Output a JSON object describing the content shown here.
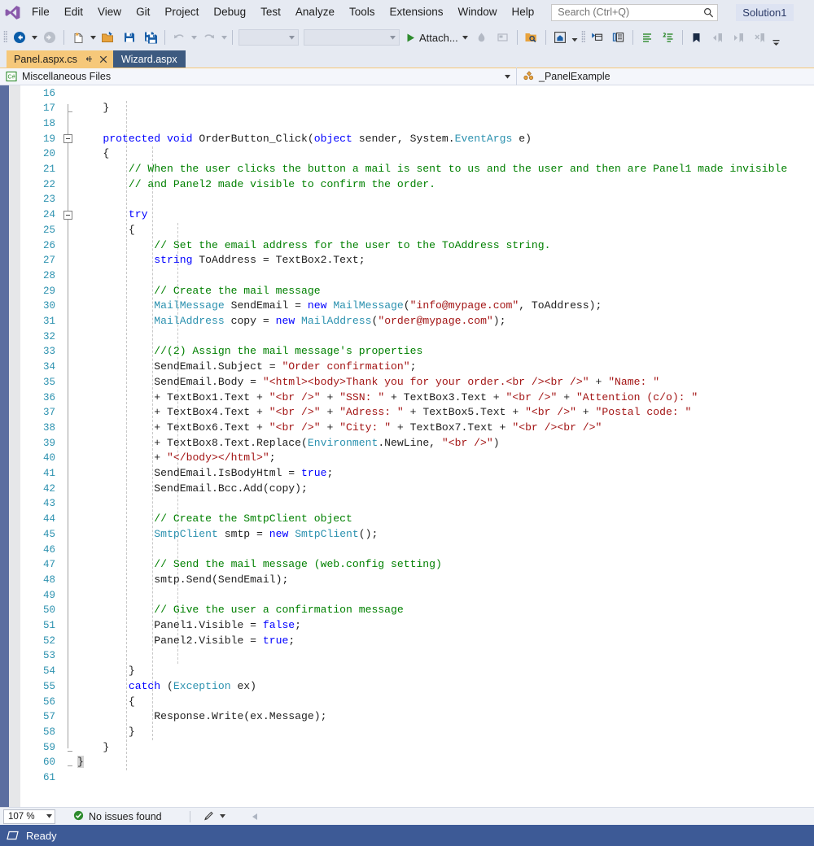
{
  "window": {
    "solution_name": "Solution1"
  },
  "menubar": {
    "logo_icon": "visual-studio-logo",
    "items": [
      {
        "label": "File"
      },
      {
        "label": "Edit"
      },
      {
        "label": "View"
      },
      {
        "label": "Git"
      },
      {
        "label": "Project"
      },
      {
        "label": "Debug"
      },
      {
        "label": "Test"
      },
      {
        "label": "Analyze"
      },
      {
        "label": "Tools"
      },
      {
        "label": "Extensions"
      },
      {
        "label": "Window"
      },
      {
        "label": "Help"
      }
    ],
    "search": {
      "placeholder": "Search (Ctrl+Q)",
      "value": "",
      "icon": "search-icon"
    }
  },
  "toolbar": {
    "attach_label": "Attach...",
    "config_combo": "",
    "platform_combo": "",
    "buttons": [
      {
        "name": "navigate-backward-button",
        "icon": "arrow-left-circle-icon"
      },
      {
        "name": "navigate-forward-button",
        "icon": "arrow-right-circle-icon"
      },
      {
        "name": "new-file-button",
        "icon": "new-file-icon"
      },
      {
        "name": "open-file-button",
        "icon": "open-folder-icon"
      },
      {
        "name": "save-button",
        "icon": "save-icon"
      },
      {
        "name": "save-all-button",
        "icon": "save-all-icon"
      },
      {
        "name": "undo-button",
        "icon": "undo-arrow-icon"
      },
      {
        "name": "redo-button",
        "icon": "redo-arrow-icon"
      },
      {
        "name": "start-debug-button",
        "icon": "play-triangle-icon"
      },
      {
        "name": "hot-reload-button",
        "icon": "flame-icon"
      },
      {
        "name": "live-preview-button",
        "icon": "monitor-icon"
      },
      {
        "name": "find-in-files-button",
        "icon": "folder-search-icon"
      },
      {
        "name": "solution-explorer-button",
        "icon": "home-window-icon"
      },
      {
        "name": "properties-window-button",
        "icon": "properties-icon"
      },
      {
        "name": "toolbox-button",
        "icon": "toolbox-icon"
      },
      {
        "name": "comment-selection-button",
        "icon": "comment-lines-icon"
      },
      {
        "name": "uncomment-selection-button",
        "icon": "uncomment-lines-icon"
      },
      {
        "name": "toggle-bookmark-button",
        "icon": "bookmark-icon"
      },
      {
        "name": "previous-bookmark-button",
        "icon": "bookmark-previous-icon"
      },
      {
        "name": "next-bookmark-button",
        "icon": "bookmark-next-icon"
      },
      {
        "name": "clear-bookmarks-button",
        "icon": "bookmark-clear-icon"
      },
      {
        "name": "toolbar-overflow-button",
        "icon": "chevron-down-icon"
      }
    ]
  },
  "tabs": [
    {
      "label": "Panel.aspx.cs",
      "active": true,
      "pin_icon": "pin-icon",
      "close_icon": "close-icon"
    },
    {
      "label": "Wizard.aspx",
      "active": false
    }
  ],
  "navbar": {
    "project": {
      "label": "Miscellaneous Files",
      "icon": "csharp-file-icon"
    },
    "member": {
      "label": "_PanelExample",
      "icon": "class-icon"
    },
    "caret_icon": "chevron-down-icon"
  },
  "editor": {
    "first_line_number": 16,
    "line_numbers": [
      16,
      17,
      18,
      19,
      20,
      21,
      22,
      23,
      24,
      25,
      26,
      27,
      28,
      29,
      30,
      31,
      32,
      33,
      34,
      35,
      36,
      37,
      38,
      39,
      40,
      41,
      42,
      43,
      44,
      45,
      46,
      47,
      48,
      49,
      50,
      51,
      52,
      53,
      54,
      55,
      56,
      57,
      58,
      59,
      60,
      61
    ],
    "collapse_boxes": [
      19,
      24
    ],
    "lines": [
      {
        "n": 16,
        "tokens": []
      },
      {
        "n": 17,
        "tokens": [
          {
            "t": "p",
            "v": "    }"
          }
        ]
      },
      {
        "n": 18,
        "tokens": []
      },
      {
        "n": 19,
        "tokens": [
          {
            "t": "k",
            "v": "    protected "
          },
          {
            "t": "k",
            "v": "void "
          },
          {
            "t": "p",
            "v": "OrderButton_Click("
          },
          {
            "t": "k",
            "v": "object"
          },
          {
            "t": "p",
            "v": " sender, System."
          },
          {
            "t": "t",
            "v": "EventArgs"
          },
          {
            "t": "p",
            "v": " e)"
          }
        ]
      },
      {
        "n": 20,
        "tokens": [
          {
            "t": "p",
            "v": "    {"
          }
        ]
      },
      {
        "n": 21,
        "tokens": [
          {
            "t": "c",
            "v": "        // When the user clicks the button a mail is sent to us and the user and then are Panel1 made invisible"
          }
        ]
      },
      {
        "n": 22,
        "tokens": [
          {
            "t": "c",
            "v": "        // and Panel2 made visible to confirm the order."
          }
        ]
      },
      {
        "n": 23,
        "tokens": []
      },
      {
        "n": 24,
        "tokens": [
          {
            "t": "k",
            "v": "        try"
          }
        ]
      },
      {
        "n": 25,
        "tokens": [
          {
            "t": "p",
            "v": "        {"
          }
        ]
      },
      {
        "n": 26,
        "tokens": [
          {
            "t": "c",
            "v": "            // Set the email address for the user to the ToAddress string."
          }
        ]
      },
      {
        "n": 27,
        "tokens": [
          {
            "t": "k",
            "v": "            string"
          },
          {
            "t": "p",
            "v": " ToAddress = TextBox2.Text;"
          }
        ]
      },
      {
        "n": 28,
        "tokens": []
      },
      {
        "n": 29,
        "tokens": [
          {
            "t": "c",
            "v": "            // Create the mail message"
          }
        ]
      },
      {
        "n": 30,
        "tokens": [
          {
            "t": "t",
            "v": "            MailMessage"
          },
          {
            "t": "p",
            "v": " SendEmail = "
          },
          {
            "t": "k",
            "v": "new "
          },
          {
            "t": "t",
            "v": "MailMessage"
          },
          {
            "t": "p",
            "v": "("
          },
          {
            "t": "s",
            "v": "\"info@mypage.com\""
          },
          {
            "t": "p",
            "v": ", ToAddress);"
          }
        ]
      },
      {
        "n": 31,
        "tokens": [
          {
            "t": "t",
            "v": "            MailAddress"
          },
          {
            "t": "p",
            "v": " copy = "
          },
          {
            "t": "k",
            "v": "new "
          },
          {
            "t": "t",
            "v": "MailAddress"
          },
          {
            "t": "p",
            "v": "("
          },
          {
            "t": "s",
            "v": "\"order@mypage.com\""
          },
          {
            "t": "p",
            "v": ");"
          }
        ]
      },
      {
        "n": 32,
        "tokens": []
      },
      {
        "n": 33,
        "tokens": [
          {
            "t": "c",
            "v": "            //(2) Assign the mail message's properties"
          }
        ]
      },
      {
        "n": 34,
        "tokens": [
          {
            "t": "p",
            "v": "            SendEmail.Subject = "
          },
          {
            "t": "s",
            "v": "\"Order confirmation\""
          },
          {
            "t": "p",
            "v": ";"
          }
        ]
      },
      {
        "n": 35,
        "tokens": [
          {
            "t": "p",
            "v": "            SendEmail.Body = "
          },
          {
            "t": "s",
            "v": "\"<html><body>Thank you for your order.<br /><br />\""
          },
          {
            "t": "p",
            "v": " + "
          },
          {
            "t": "s",
            "v": "\"Name: \""
          }
        ]
      },
      {
        "n": 36,
        "tokens": [
          {
            "t": "p",
            "v": "            + TextBox1.Text + "
          },
          {
            "t": "s",
            "v": "\"<br />\""
          },
          {
            "t": "p",
            "v": " + "
          },
          {
            "t": "s",
            "v": "\"SSN: \""
          },
          {
            "t": "p",
            "v": " + TextBox3.Text + "
          },
          {
            "t": "s",
            "v": "\"<br />\""
          },
          {
            "t": "p",
            "v": " + "
          },
          {
            "t": "s",
            "v": "\"Attention (c/o): \""
          }
        ]
      },
      {
        "n": 37,
        "tokens": [
          {
            "t": "p",
            "v": "            + TextBox4.Text + "
          },
          {
            "t": "s",
            "v": "\"<br />\""
          },
          {
            "t": "p",
            "v": " + "
          },
          {
            "t": "s",
            "v": "\"Adress: \""
          },
          {
            "t": "p",
            "v": " + TextBox5.Text + "
          },
          {
            "t": "s",
            "v": "\"<br />\""
          },
          {
            "t": "p",
            "v": " + "
          },
          {
            "t": "s",
            "v": "\"Postal code: \""
          }
        ]
      },
      {
        "n": 38,
        "tokens": [
          {
            "t": "p",
            "v": "            + TextBox6.Text + "
          },
          {
            "t": "s",
            "v": "\"<br />\""
          },
          {
            "t": "p",
            "v": " + "
          },
          {
            "t": "s",
            "v": "\"City: \""
          },
          {
            "t": "p",
            "v": " + TextBox7.Text + "
          },
          {
            "t": "s",
            "v": "\"<br /><br />\""
          }
        ]
      },
      {
        "n": 39,
        "tokens": [
          {
            "t": "p",
            "v": "            + TextBox8.Text.Replace("
          },
          {
            "t": "t",
            "v": "Environment"
          },
          {
            "t": "p",
            "v": ".NewLine, "
          },
          {
            "t": "s",
            "v": "\"<br />\""
          },
          {
            "t": "p",
            "v": ")"
          }
        ]
      },
      {
        "n": 40,
        "tokens": [
          {
            "t": "p",
            "v": "            + "
          },
          {
            "t": "s",
            "v": "\"</body></html>\""
          },
          {
            "t": "p",
            "v": ";"
          }
        ]
      },
      {
        "n": 41,
        "tokens": [
          {
            "t": "p",
            "v": "            SendEmail.IsBodyHtml = "
          },
          {
            "t": "k",
            "v": "true"
          },
          {
            "t": "p",
            "v": ";"
          }
        ]
      },
      {
        "n": 42,
        "tokens": [
          {
            "t": "p",
            "v": "            SendEmail.Bcc.Add(copy);"
          }
        ]
      },
      {
        "n": 43,
        "tokens": []
      },
      {
        "n": 44,
        "tokens": [
          {
            "t": "c",
            "v": "            // Create the SmtpClient object"
          }
        ]
      },
      {
        "n": 45,
        "tokens": [
          {
            "t": "t",
            "v": "            SmtpClient"
          },
          {
            "t": "p",
            "v": " smtp = "
          },
          {
            "t": "k",
            "v": "new "
          },
          {
            "t": "t",
            "v": "SmtpClient"
          },
          {
            "t": "p",
            "v": "();"
          }
        ]
      },
      {
        "n": 46,
        "tokens": []
      },
      {
        "n": 47,
        "tokens": [
          {
            "t": "c",
            "v": "            // Send the mail message (web.config setting)"
          }
        ]
      },
      {
        "n": 48,
        "tokens": [
          {
            "t": "p",
            "v": "            smtp.Send(SendEmail);"
          }
        ]
      },
      {
        "n": 49,
        "tokens": []
      },
      {
        "n": 50,
        "tokens": [
          {
            "t": "c",
            "v": "            // Give the user a confirmation message"
          }
        ]
      },
      {
        "n": 51,
        "tokens": [
          {
            "t": "p",
            "v": "            Panel1.Visible = "
          },
          {
            "t": "k",
            "v": "false"
          },
          {
            "t": "p",
            "v": ";"
          }
        ]
      },
      {
        "n": 52,
        "tokens": [
          {
            "t": "p",
            "v": "            Panel2.Visible = "
          },
          {
            "t": "k",
            "v": "true"
          },
          {
            "t": "p",
            "v": ";"
          }
        ]
      },
      {
        "n": 53,
        "tokens": []
      },
      {
        "n": 54,
        "tokens": [
          {
            "t": "p",
            "v": "        }"
          }
        ]
      },
      {
        "n": 55,
        "tokens": [
          {
            "t": "k",
            "v": "        catch "
          },
          {
            "t": "p",
            "v": "("
          },
          {
            "t": "t",
            "v": "Exception"
          },
          {
            "t": "p",
            "v": " ex)"
          }
        ]
      },
      {
        "n": 56,
        "tokens": [
          {
            "t": "p",
            "v": "        {"
          }
        ]
      },
      {
        "n": 57,
        "tokens": [
          {
            "t": "p",
            "v": "            Response.Write(ex.Message);"
          }
        ]
      },
      {
        "n": 58,
        "tokens": [
          {
            "t": "p",
            "v": "        }"
          }
        ]
      },
      {
        "n": 59,
        "tokens": [
          {
            "t": "p",
            "v": "    }"
          }
        ]
      },
      {
        "n": 60,
        "tokens": [
          {
            "t": "p",
            "v": "}"
          }
        ]
      },
      {
        "n": 61,
        "tokens": []
      }
    ]
  },
  "editor_status": {
    "zoom_level": "107 %",
    "issues_label": "No issues found",
    "issues_icon": "check-circle-icon",
    "pen_icon": "pen-icon",
    "caret_icon": "chevron-down-icon",
    "prev_icon": "triangle-left-icon"
  },
  "statusbar": {
    "ready_label": "Ready",
    "icon": "window-icon"
  },
  "colors": {
    "accent_blue": "#3d5a96",
    "tab_active": "#f6c87a",
    "tab_inactive": "#3d5a80",
    "keyword": "#0000ff",
    "type": "#2b91af",
    "string": "#a31515",
    "comment": "#008000",
    "line_number": "#2b91af",
    "chrome": "#e6eaf2"
  }
}
